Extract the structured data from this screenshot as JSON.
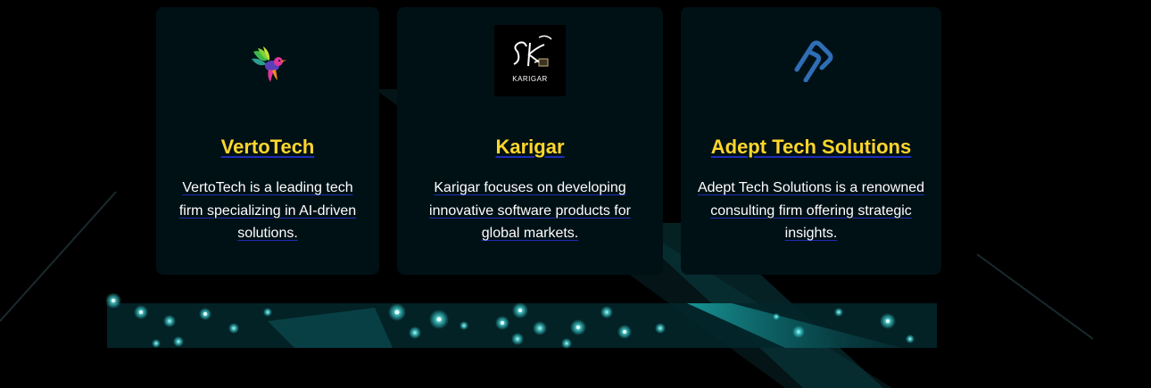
{
  "cards": [
    {
      "title": "VertoTech",
      "description": "VertoTech is a leading tech firm specializing in AI-driven solutions.",
      "logo_icon": "hummingbird-icon"
    },
    {
      "title": "Karigar",
      "description": "Karigar focuses on developing innovative software products for global markets.",
      "logo_icon": "karigar-logo",
      "logo_text": "KARIGAR"
    },
    {
      "title": "Adept Tech Solutions",
      "description": "Adept Tech Solutions is a renowned consulting firm offering strategic insights.",
      "logo_icon": "adept-logo-icon"
    }
  ],
  "colors": {
    "card_background": "#001116",
    "title": "#ffd62a",
    "text": "#ffffff",
    "underline": "#1e2db8",
    "sparkle": "#3fe0e0",
    "page_background": "#000000"
  }
}
